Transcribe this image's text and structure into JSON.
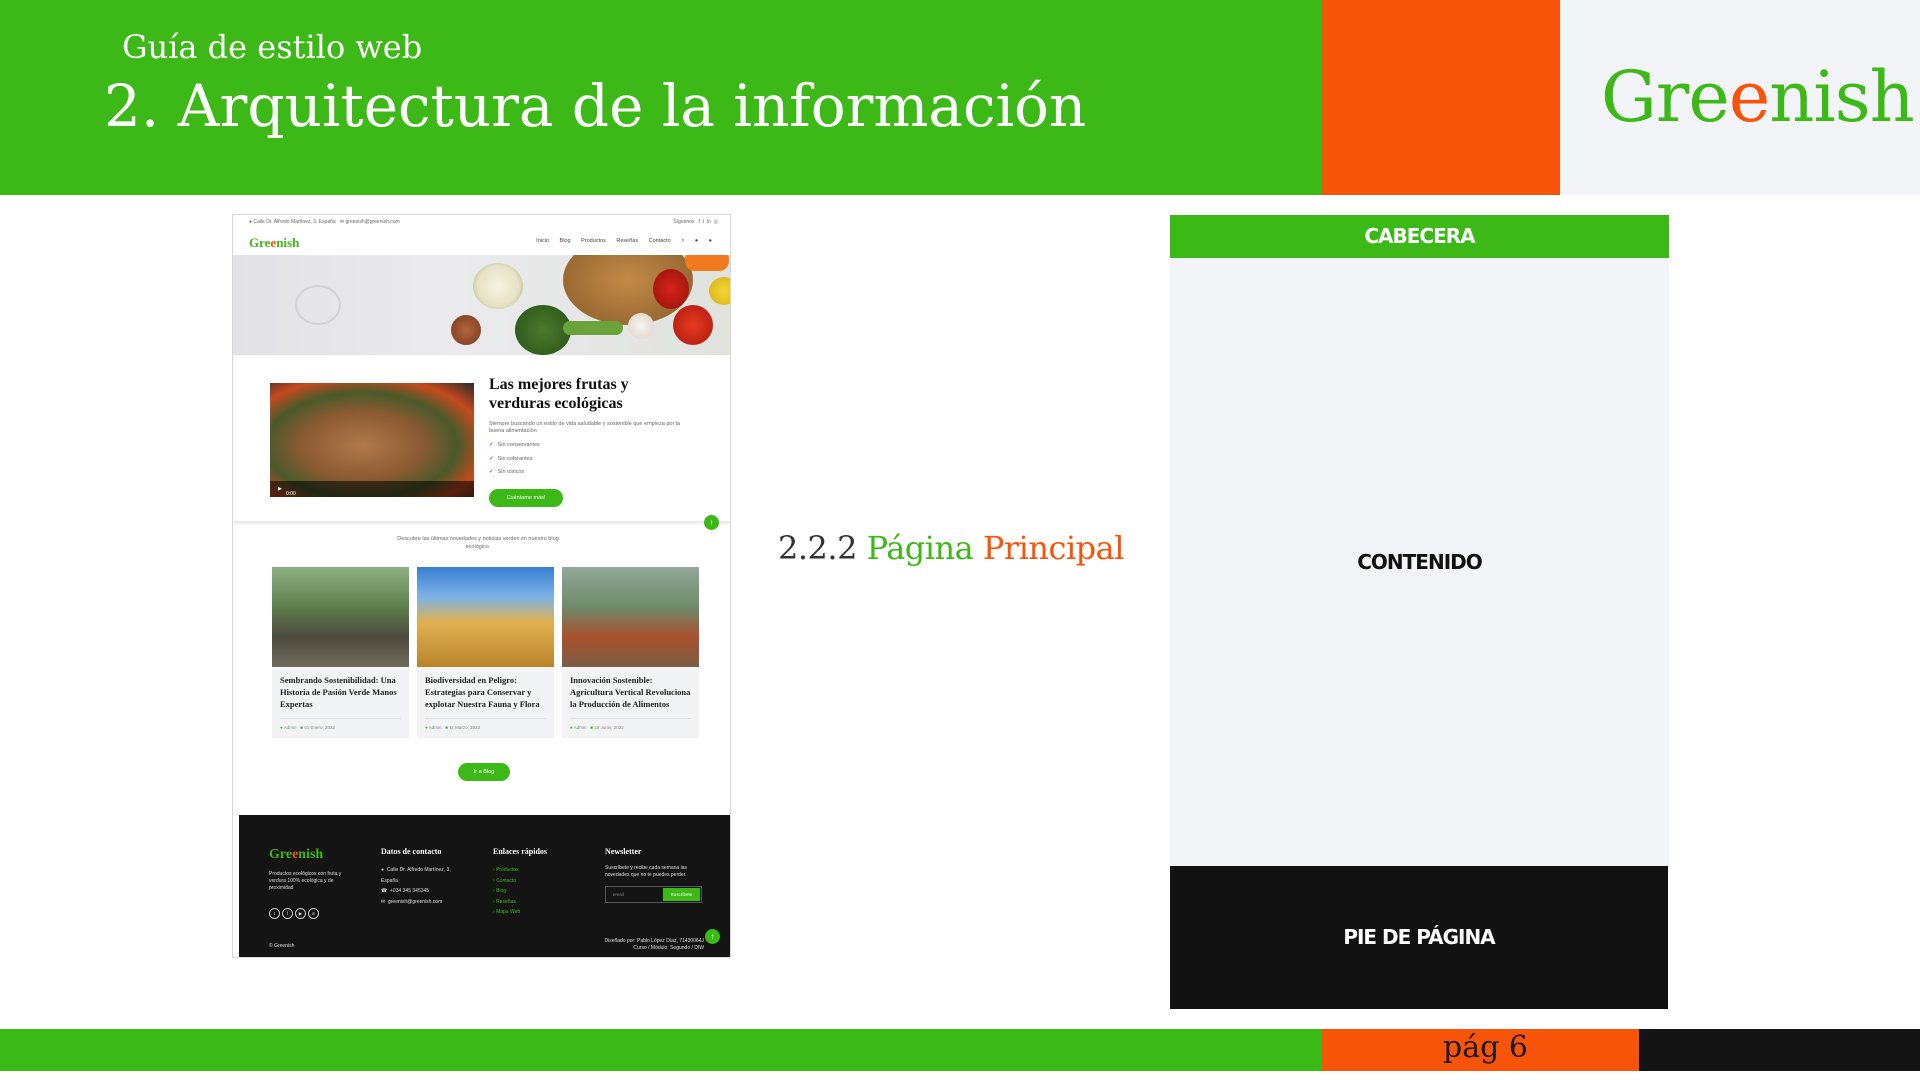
{
  "slide": {
    "subtitle": "Guía de estilo web",
    "title": "2. Arquitectura de la información",
    "logo_part1": "Gre",
    "logo_part2": "e",
    "logo_part3": "nish",
    "section_number": "2.2.2",
    "section_word1": "Página",
    "section_word2": "Principal",
    "page_number": "pág 6",
    "colors": {
      "green": "#3cb916",
      "orange": "#f75309",
      "light_gray": "#f3f4f8",
      "black": "#141414"
    }
  },
  "wireframe": {
    "header": "CABECERA",
    "content": "CONTENIDO",
    "footer": "PIE DE PÁGINA"
  },
  "mockup": {
    "topbar": {
      "address": "Calle Dr. Alfredo Martínez, 3, España",
      "email": "greenish@greenish.com",
      "follow": "Síguenos",
      "social_icons": [
        "facebook-icon",
        "twitter-icon",
        "linkedin-icon",
        "instagram-icon"
      ]
    },
    "nav": {
      "logo_part1": "Gre",
      "logo_part2": "e",
      "logo_part3": "nish",
      "links": [
        "Inicio",
        "Blog",
        "Productos",
        "Reseñas",
        "Contacto"
      ],
      "icons": [
        "search-icon",
        "user-icon",
        "cart-icon"
      ]
    },
    "feature": {
      "title": "Las mejores frutas y verduras ecológicas",
      "description": "Siempre buscando un estilo de vida saludable y sostenible que empieza por la buena alimentación",
      "checks": [
        "Sin conservantes",
        "Sin colorantes",
        "Sin tóxicos"
      ],
      "button": "Cuéntame más!",
      "video_time": "0:00 / 0:41"
    },
    "blog": {
      "intro": "Descubre las últimas novedades y noticias verdes en nuestro blog ecológico.",
      "cards": [
        {
          "title": "Sembrando Sostenibilidad: Una Historia de Pasión Verde Manos Expertas",
          "author": "Admin",
          "date": "01 Enero, 2022"
        },
        {
          "title": "Biodiversidad en Peligro: Estrategias para Conservar y explotar Nuestra Fauna y Flora",
          "author": "Admin",
          "date": "11 Marzo, 2022"
        },
        {
          "title": "Innovación Sostenible: Agricultura Vertical Revoluciona la Producción de Alimentos",
          "author": "Admin",
          "date": "19 Junio, 2022"
        }
      ],
      "button": "Ir a Blog"
    },
    "footer": {
      "logo_part1": "Gre",
      "logo_part2": "e",
      "logo_part3": "nish",
      "description": "Productos ecológicos con fruta y verdura 100% ecológica y de proximidad",
      "contact_title": "Datos de contacto",
      "contact": [
        "Calle Dr. Alfredo Martínez, 3, España",
        "+034 345 345345",
        "greenish@greenish.com"
      ],
      "links_title": "Enlaces rápidos",
      "links": [
        "Productos",
        "Contacto",
        "Blog",
        "Reseñas",
        "Mapa Web"
      ],
      "newsletter_title": "Newsletter",
      "newsletter_text": "Suscríbete y recibe cada semana las novedades que no te puedes perder.",
      "email_placeholder": "email",
      "subscribe": "Suscríbete",
      "copyright": "© Greenish",
      "credit_line1": "Diseñado por: Pablo López Díaz, 71430064J",
      "credit_line2": "Curso / Módulo: Segundo / DIW"
    }
  }
}
